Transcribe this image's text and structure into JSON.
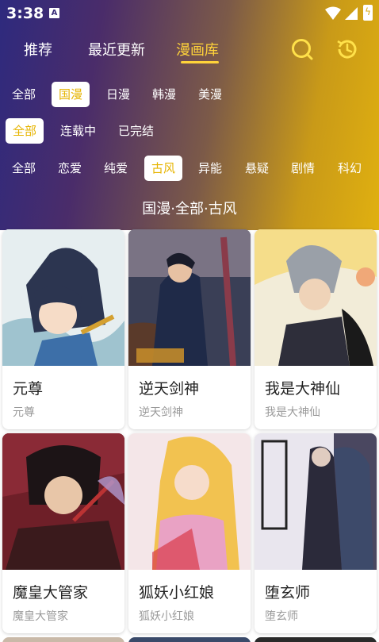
{
  "status": {
    "time": "3:38"
  },
  "tabs": [
    {
      "label": "推荐"
    },
    {
      "label": "最近更新"
    },
    {
      "label": "漫画库"
    }
  ],
  "filters": {
    "region": [
      "全部",
      "国漫",
      "日漫",
      "韩漫",
      "美漫"
    ],
    "status": [
      "全部",
      "连载中",
      "已完结"
    ],
    "genre": [
      "全部",
      "恋爱",
      "纯爱",
      "古风",
      "异能",
      "悬疑",
      "剧情",
      "科幻"
    ],
    "selected": {
      "region": "国漫",
      "status": "全部",
      "genre": "古风"
    }
  },
  "filter_title": "国漫·全部·古风",
  "comics": [
    {
      "title": "元尊",
      "subtitle": "元尊"
    },
    {
      "title": "逆天剑神",
      "subtitle": "逆天剑神"
    },
    {
      "title": "我是大神仙",
      "subtitle": "我是大神仙"
    },
    {
      "title": "魔皇大管家",
      "subtitle": "魔皇大管家"
    },
    {
      "title": "狐妖小红娘",
      "subtitle": "狐妖小红娘"
    },
    {
      "title": "堕玄师",
      "subtitle": "堕玄师"
    }
  ],
  "colors": {
    "accent": "#ffd33a",
    "chip_selected_text": "#e6b400"
  }
}
